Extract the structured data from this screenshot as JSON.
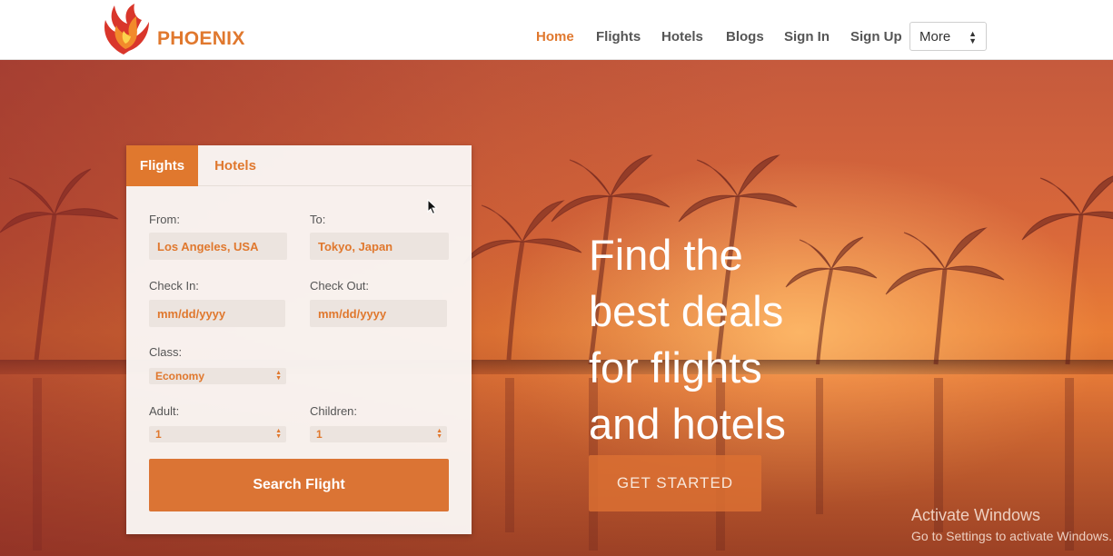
{
  "brand": {
    "name": "PHOENIX",
    "logo_icon": "phoenix-bird-icon",
    "accent_color": "#e0782e"
  },
  "nav": {
    "items": [
      {
        "label": "Home",
        "active": true
      },
      {
        "label": "Flights",
        "active": false
      },
      {
        "label": "Hotels",
        "active": false
      },
      {
        "label": "Blogs",
        "active": false
      },
      {
        "label": "Sign In",
        "active": false
      },
      {
        "label": "Sign Up",
        "active": false
      }
    ],
    "more_select": "More"
  },
  "search_panel": {
    "tabs": [
      {
        "label": "Flights",
        "active": true
      },
      {
        "label": "Hotels",
        "active": false
      }
    ],
    "from": {
      "label": "From:",
      "value": "Los Angeles, USA"
    },
    "to": {
      "label": "To:",
      "value": "Tokyo, Japan"
    },
    "check_in": {
      "label": "Check In:",
      "value": "mm/dd/yyyy"
    },
    "check_out": {
      "label": "Check Out:",
      "value": "mm/dd/yyyy"
    },
    "class": {
      "label": "Class:",
      "value": "Economy"
    },
    "adult": {
      "label": "Adult:",
      "value": "1"
    },
    "children": {
      "label": "Children:",
      "value": "1"
    },
    "submit_label": "Search Flight"
  },
  "hero": {
    "title_lines": [
      "Find the",
      "best deals",
      "for flights",
      "and hotels"
    ],
    "cta_label": "GET STARTED"
  },
  "watermark": {
    "line1": "Activate Windows",
    "line2": "Go to Settings to activate Windows."
  }
}
